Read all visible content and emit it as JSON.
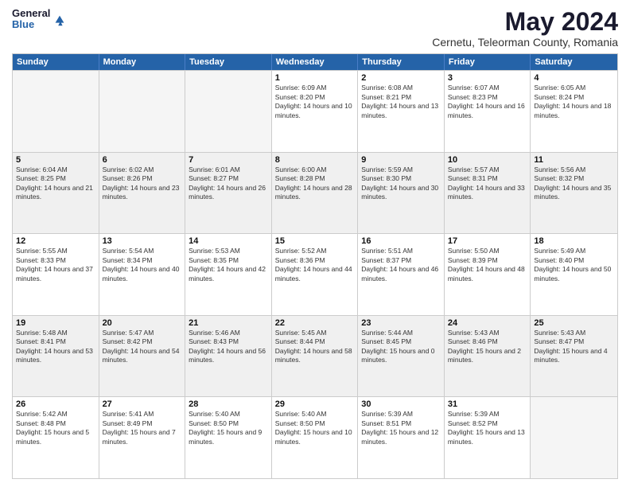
{
  "header": {
    "logo_general": "General",
    "logo_blue": "Blue",
    "month_title": "May 2024",
    "subtitle": "Cernetu, Teleorman County, Romania"
  },
  "calendar": {
    "days_of_week": [
      "Sunday",
      "Monday",
      "Tuesday",
      "Wednesday",
      "Thursday",
      "Friday",
      "Saturday"
    ],
    "rows": [
      [
        {
          "day": "",
          "empty": true
        },
        {
          "day": "",
          "empty": true
        },
        {
          "day": "",
          "empty": true
        },
        {
          "day": "1",
          "sunrise": "6:09 AM",
          "sunset": "8:20 PM",
          "daylight": "14 hours and 10 minutes."
        },
        {
          "day": "2",
          "sunrise": "6:08 AM",
          "sunset": "8:21 PM",
          "daylight": "14 hours and 13 minutes."
        },
        {
          "day": "3",
          "sunrise": "6:07 AM",
          "sunset": "8:23 PM",
          "daylight": "14 hours and 16 minutes."
        },
        {
          "day": "4",
          "sunrise": "6:05 AM",
          "sunset": "8:24 PM",
          "daylight": "14 hours and 18 minutes."
        }
      ],
      [
        {
          "day": "5",
          "sunrise": "6:04 AM",
          "sunset": "8:25 PM",
          "daylight": "14 hours and 21 minutes."
        },
        {
          "day": "6",
          "sunrise": "6:02 AM",
          "sunset": "8:26 PM",
          "daylight": "14 hours and 23 minutes."
        },
        {
          "day": "7",
          "sunrise": "6:01 AM",
          "sunset": "8:27 PM",
          "daylight": "14 hours and 26 minutes."
        },
        {
          "day": "8",
          "sunrise": "6:00 AM",
          "sunset": "8:28 PM",
          "daylight": "14 hours and 28 minutes."
        },
        {
          "day": "9",
          "sunrise": "5:59 AM",
          "sunset": "8:30 PM",
          "daylight": "14 hours and 30 minutes."
        },
        {
          "day": "10",
          "sunrise": "5:57 AM",
          "sunset": "8:31 PM",
          "daylight": "14 hours and 33 minutes."
        },
        {
          "day": "11",
          "sunrise": "5:56 AM",
          "sunset": "8:32 PM",
          "daylight": "14 hours and 35 minutes."
        }
      ],
      [
        {
          "day": "12",
          "sunrise": "5:55 AM",
          "sunset": "8:33 PM",
          "daylight": "14 hours and 37 minutes."
        },
        {
          "day": "13",
          "sunrise": "5:54 AM",
          "sunset": "8:34 PM",
          "daylight": "14 hours and 40 minutes."
        },
        {
          "day": "14",
          "sunrise": "5:53 AM",
          "sunset": "8:35 PM",
          "daylight": "14 hours and 42 minutes."
        },
        {
          "day": "15",
          "sunrise": "5:52 AM",
          "sunset": "8:36 PM",
          "daylight": "14 hours and 44 minutes."
        },
        {
          "day": "16",
          "sunrise": "5:51 AM",
          "sunset": "8:37 PM",
          "daylight": "14 hours and 46 minutes."
        },
        {
          "day": "17",
          "sunrise": "5:50 AM",
          "sunset": "8:39 PM",
          "daylight": "14 hours and 48 minutes."
        },
        {
          "day": "18",
          "sunrise": "5:49 AM",
          "sunset": "8:40 PM",
          "daylight": "14 hours and 50 minutes."
        }
      ],
      [
        {
          "day": "19",
          "sunrise": "5:48 AM",
          "sunset": "8:41 PM",
          "daylight": "14 hours and 53 minutes."
        },
        {
          "day": "20",
          "sunrise": "5:47 AM",
          "sunset": "8:42 PM",
          "daylight": "14 hours and 54 minutes."
        },
        {
          "day": "21",
          "sunrise": "5:46 AM",
          "sunset": "8:43 PM",
          "daylight": "14 hours and 56 minutes."
        },
        {
          "day": "22",
          "sunrise": "5:45 AM",
          "sunset": "8:44 PM",
          "daylight": "14 hours and 58 minutes."
        },
        {
          "day": "23",
          "sunrise": "5:44 AM",
          "sunset": "8:45 PM",
          "daylight": "15 hours and 0 minutes."
        },
        {
          "day": "24",
          "sunrise": "5:43 AM",
          "sunset": "8:46 PM",
          "daylight": "15 hours and 2 minutes."
        },
        {
          "day": "25",
          "sunrise": "5:43 AM",
          "sunset": "8:47 PM",
          "daylight": "15 hours and 4 minutes."
        }
      ],
      [
        {
          "day": "26",
          "sunrise": "5:42 AM",
          "sunset": "8:48 PM",
          "daylight": "15 hours and 5 minutes."
        },
        {
          "day": "27",
          "sunrise": "5:41 AM",
          "sunset": "8:49 PM",
          "daylight": "15 hours and 7 minutes."
        },
        {
          "day": "28",
          "sunrise": "5:40 AM",
          "sunset": "8:50 PM",
          "daylight": "15 hours and 9 minutes."
        },
        {
          "day": "29",
          "sunrise": "5:40 AM",
          "sunset": "8:50 PM",
          "daylight": "15 hours and 10 minutes."
        },
        {
          "day": "30",
          "sunrise": "5:39 AM",
          "sunset": "8:51 PM",
          "daylight": "15 hours and 12 minutes."
        },
        {
          "day": "31",
          "sunrise": "5:39 AM",
          "sunset": "8:52 PM",
          "daylight": "15 hours and 13 minutes."
        },
        {
          "day": "",
          "empty": true
        }
      ]
    ]
  }
}
